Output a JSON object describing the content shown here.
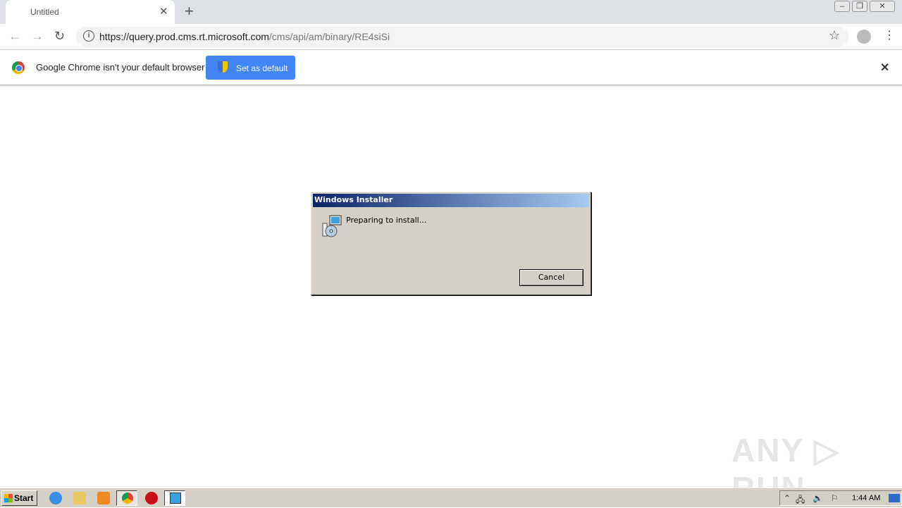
{
  "browser": {
    "tab_title": "Untitled",
    "url_host": "https://query.prod.cms.rt.microsoft.com",
    "url_path": "/cms/api/am/binary/RE4siSi",
    "infobar_text": "Google Chrome isn't your default browser",
    "set_default_label": "Set as default"
  },
  "dialog": {
    "title": "Windows Installer",
    "message": "Preparing to install...",
    "cancel_label": "Cancel"
  },
  "watermark": "ANY ▷ RUN",
  "taskbar": {
    "start_label": "Start",
    "clock": "1:44 AM"
  }
}
